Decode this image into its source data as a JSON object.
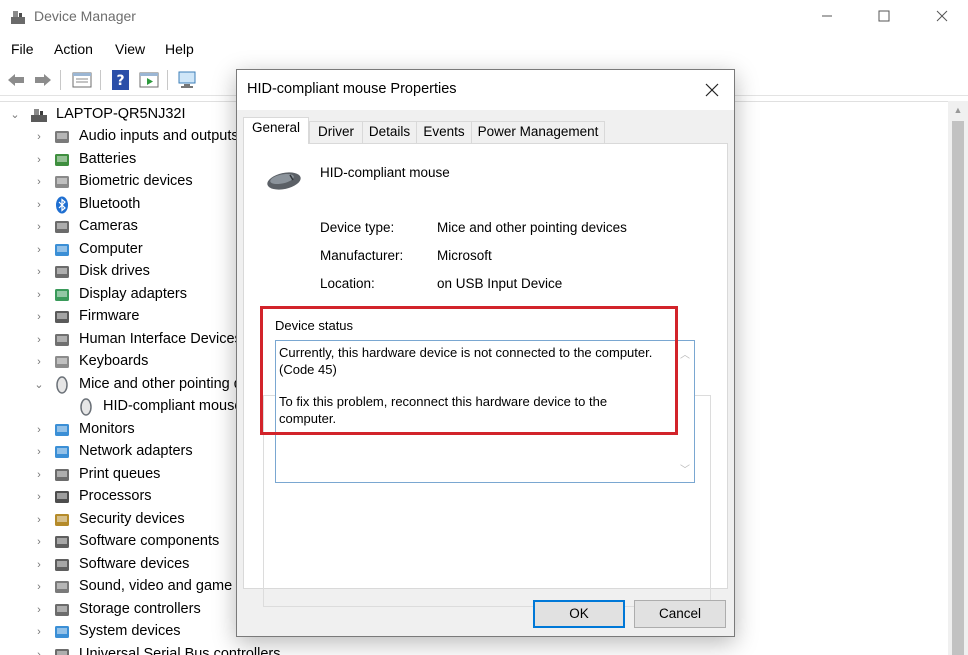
{
  "window": {
    "title": "Device Manager"
  },
  "menu": [
    "File",
    "Action",
    "View",
    "Help"
  ],
  "tree": {
    "root": "LAPTOP-QR5NJ32I",
    "items": [
      {
        "label": "Audio inputs and outputs",
        "icon": "speaker-icon"
      },
      {
        "label": "Batteries",
        "icon": "battery-icon"
      },
      {
        "label": "Biometric devices",
        "icon": "fingerprint-icon"
      },
      {
        "label": "Bluetooth",
        "icon": "bluetooth-icon"
      },
      {
        "label": "Cameras",
        "icon": "camera-icon"
      },
      {
        "label": "Computer",
        "icon": "computer-icon"
      },
      {
        "label": "Disk drives",
        "icon": "disk-drive-icon"
      },
      {
        "label": "Display adapters",
        "icon": "display-adapter-icon"
      },
      {
        "label": "Firmware",
        "icon": "firmware-icon"
      },
      {
        "label": "Human Interface Devices",
        "icon": "hid-icon"
      },
      {
        "label": "Keyboards",
        "icon": "keyboard-icon"
      },
      {
        "label": "Mice and other pointing devices",
        "icon": "mouse-icon",
        "expanded": true
      },
      {
        "label": "HID-compliant mouse",
        "icon": "mouse-icon",
        "child": true
      },
      {
        "label": "Monitors",
        "icon": "monitor-icon"
      },
      {
        "label": "Network adapters",
        "icon": "network-adapter-icon"
      },
      {
        "label": "Print queues",
        "icon": "printer-icon"
      },
      {
        "label": "Processors",
        "icon": "processor-icon"
      },
      {
        "label": "Security devices",
        "icon": "security-device-icon"
      },
      {
        "label": "Software components",
        "icon": "software-component-icon"
      },
      {
        "label": "Software devices",
        "icon": "software-device-icon"
      },
      {
        "label": "Sound, video and game controllers",
        "icon": "speaker-icon"
      },
      {
        "label": "Storage controllers",
        "icon": "storage-controller-icon"
      },
      {
        "label": "System devices",
        "icon": "system-device-icon"
      },
      {
        "label": "Universal Serial Bus controllers",
        "icon": "usb-icon"
      }
    ]
  },
  "dialog": {
    "title": "HID-compliant mouse Properties",
    "tabs": [
      "General",
      "Driver",
      "Details",
      "Events",
      "Power Management"
    ],
    "device_name": "HID-compliant mouse",
    "props": {
      "type_label": "Device type:",
      "type_value": "Mice and other pointing devices",
      "manufacturer_label": "Manufacturer:",
      "manufacturer_value": "Microsoft",
      "location_label": "Location:",
      "location_value": "on USB Input Device"
    },
    "status": {
      "title": "Device status",
      "line1": "Currently, this hardware device is not connected to the computer.",
      "line2": "(Code 45)",
      "line3": "To fix this problem, reconnect this hardware device to the",
      "line4": "computer."
    },
    "ok_label": "OK",
    "cancel_label": "Cancel"
  },
  "colors": {
    "accent": "#0078d7",
    "highlight": "#d2232a"
  }
}
